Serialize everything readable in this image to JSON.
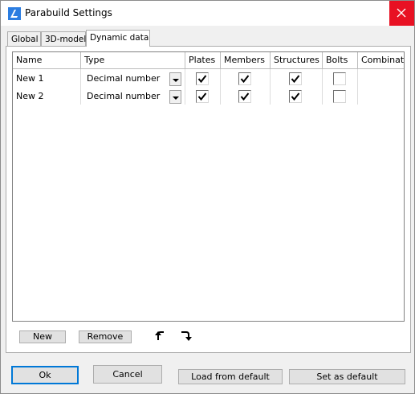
{
  "window": {
    "title": "Parabuild Settings"
  },
  "tabs": [
    {
      "label": "Global"
    },
    {
      "label": "3D-model"
    },
    {
      "label": "Dynamic data"
    }
  ],
  "grid": {
    "columns": [
      "Name",
      "Type",
      "Plates",
      "Members",
      "Structures",
      "Bolts",
      "Combinat"
    ],
    "rows": [
      {
        "name": "New 1",
        "type": "Decimal number",
        "plates": true,
        "members": true,
        "structures": true,
        "bolts": false
      },
      {
        "name": "New 2",
        "type": "Decimal number",
        "plates": true,
        "members": true,
        "structures": true,
        "bolts": false
      }
    ]
  },
  "panel_buttons": {
    "new": "New",
    "remove": "Remove"
  },
  "icons": {
    "move_up": "arrow-turn-up-icon",
    "move_down": "arrow-turn-down-icon"
  },
  "buttons": {
    "ok": "Ok",
    "cancel": "Cancel",
    "load_default": "Load from default",
    "set_default": "Set as default"
  },
  "colors": {
    "close": "#e81123",
    "accent": "#0078d7"
  }
}
